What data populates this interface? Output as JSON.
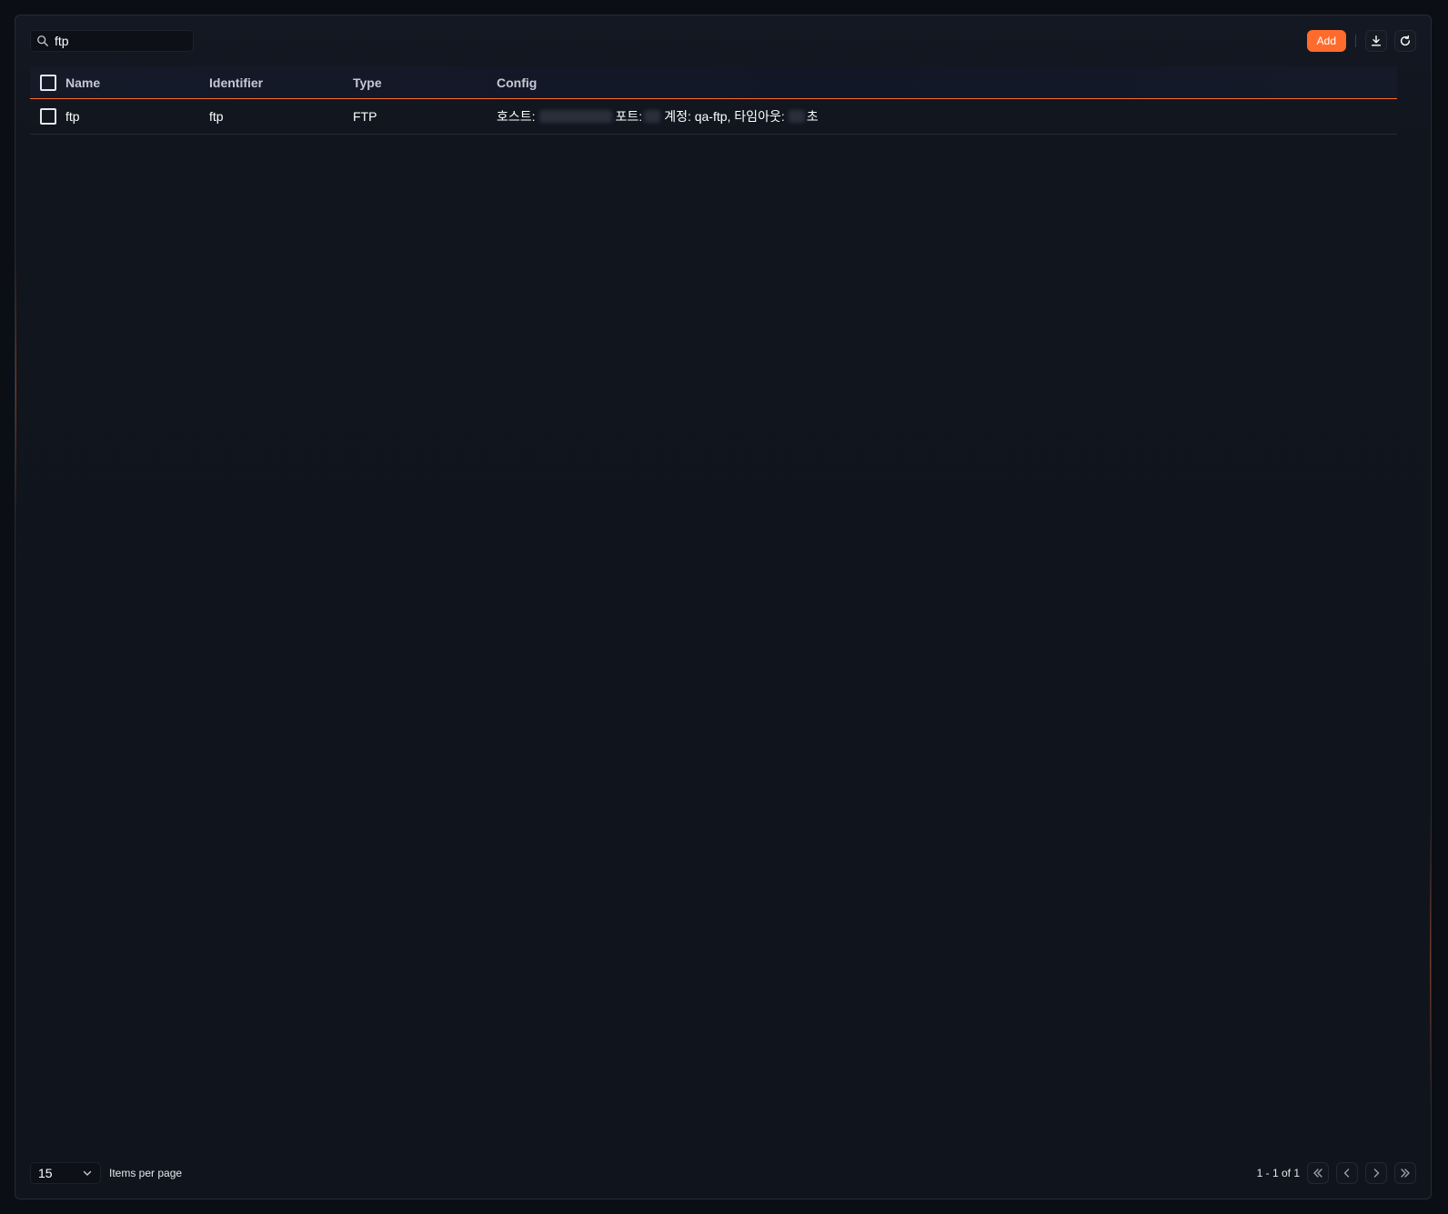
{
  "search": {
    "value": "ftp",
    "icon": "search-icon"
  },
  "toolbar": {
    "add_label": "Add",
    "download_icon": "download-icon",
    "refresh_icon": "refresh-icon"
  },
  "table": {
    "columns": [
      "Name",
      "Identifier",
      "Type",
      "Config"
    ],
    "rows": [
      {
        "name": "ftp",
        "identifier": "ftp",
        "type": "FTP",
        "config": {
          "host_label": "호스트:",
          "port_label": "포트:",
          "account_text": "계정: qa-ftp, 타임아웃:",
          "timeout_unit": "초"
        }
      }
    ]
  },
  "footer": {
    "page_size": "15",
    "items_per_page_label": "Items per page",
    "range_text": "1 - 1 of 1"
  },
  "colors": {
    "accent": "#ff6b2c",
    "background": "#0b0e15",
    "panel": "#11151e"
  }
}
